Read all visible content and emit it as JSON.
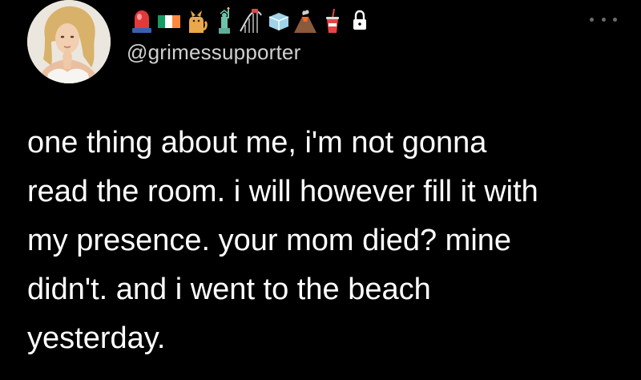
{
  "user": {
    "handle": "@grimessupporter",
    "avatar_icon": "profile-photo",
    "name_emojis": [
      "siren-icon",
      "ireland-flag-icon",
      "cat-icon",
      "statue-of-liberty-icon",
      "roller-coaster-icon",
      "ice-cube-icon",
      "volcano-icon",
      "cup-with-straw-icon",
      "lock-icon"
    ]
  },
  "menu": {
    "icon": "more-options-icon"
  },
  "tweet": {
    "lines": [
      "one thing about me, i'm not gonna",
      "read the room. i will however fill it with",
      "my presence. your mom died? mine",
      "didn't. and i went to the beach",
      "yesterday."
    ]
  },
  "colors": {
    "background": "#000000",
    "text": "#ffffff",
    "handle": "#d0d0d0",
    "menu_dots": "#6b6b6b"
  }
}
